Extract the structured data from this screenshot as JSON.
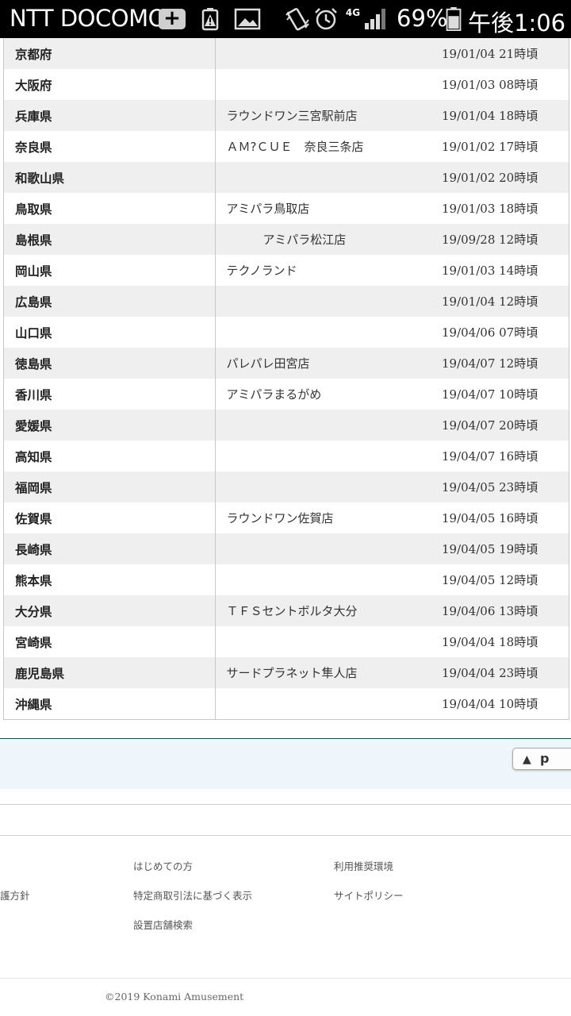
{
  "status_bar": {
    "carrier": "NTT DOCOMO",
    "network": "4G",
    "battery_percent": "69%",
    "time": "午後1:06",
    "icons": [
      "plus-icon",
      "battery-warning-icon",
      "image-icon",
      "vibrate-icon",
      "alarm-icon",
      "signal-icon",
      "battery-icon"
    ]
  },
  "table": {
    "rows": [
      {
        "prefecture": "京都府",
        "store": "",
        "datetime": "19/01/04 21時頃"
      },
      {
        "prefecture": "大阪府",
        "store": "",
        "datetime": "19/01/03 08時頃"
      },
      {
        "prefecture": "兵庫県",
        "store": "ラウンドワン三宮駅前店",
        "datetime": "19/01/04 18時頃"
      },
      {
        "prefecture": "奈良県",
        "store": "ＡＭ?ＣＵＥ　奈良三条店",
        "datetime": "19/01/02 17時頃"
      },
      {
        "prefecture": "和歌山県",
        "store": "",
        "datetime": "19/01/02 20時頃"
      },
      {
        "prefecture": "鳥取県",
        "store": "アミパラ鳥取店",
        "datetime": "19/01/03 18時頃"
      },
      {
        "prefecture": "島根県",
        "store": "アミパラ松江店",
        "datetime": "19/09/28 12時頃"
      },
      {
        "prefecture": "岡山県",
        "store": "テクノランド",
        "datetime": "19/01/03 14時頃"
      },
      {
        "prefecture": "広島県",
        "store": "",
        "datetime": "19/01/04 12時頃"
      },
      {
        "prefecture": "山口県",
        "store": "",
        "datetime": "19/04/06 07時頃"
      },
      {
        "prefecture": "徳島県",
        "store": "パレパレ田宮店",
        "datetime": "19/04/07 12時頃"
      },
      {
        "prefecture": "香川県",
        "store": "アミパラまるがめ",
        "datetime": "19/04/07 10時頃"
      },
      {
        "prefecture": "愛媛県",
        "store": "",
        "datetime": "19/04/07 20時頃"
      },
      {
        "prefecture": "高知県",
        "store": "",
        "datetime": "19/04/07 16時頃"
      },
      {
        "prefecture": "福岡県",
        "store": "",
        "datetime": "19/04/05 23時頃"
      },
      {
        "prefecture": "佐賀県",
        "store": "ラウンドワン佐賀店",
        "datetime": "19/04/05 16時頃"
      },
      {
        "prefecture": "長崎県",
        "store": "",
        "datetime": "19/04/05 19時頃"
      },
      {
        "prefecture": "熊本県",
        "store": "",
        "datetime": "19/04/05 12時頃"
      },
      {
        "prefecture": "大分県",
        "store": "ＴＦＳセントボルタ大分",
        "datetime": "19/04/06 13時頃"
      },
      {
        "prefecture": "宮崎県",
        "store": "",
        "datetime": "19/04/04 18時頃"
      },
      {
        "prefecture": "鹿児島県",
        "store": "サードプラネット隼人店",
        "datetime": "19/04/04 23時頃"
      },
      {
        "prefecture": "沖縄県",
        "store": "",
        "datetime": "19/04/04 10時頃"
      }
    ]
  },
  "page_top": {
    "label": "p",
    "arrow": "▲"
  },
  "footer": {
    "links": {
      "privacy_partial": "護方針",
      "beginners": "はじめての方",
      "environment": "利用推奨環境",
      "commerce_law": "特定商取引法に基づく表示",
      "site_policy": "サイトポリシー",
      "store_search": "設置店舗検索"
    },
    "copyright": "©2019 Konami Amusement"
  }
}
